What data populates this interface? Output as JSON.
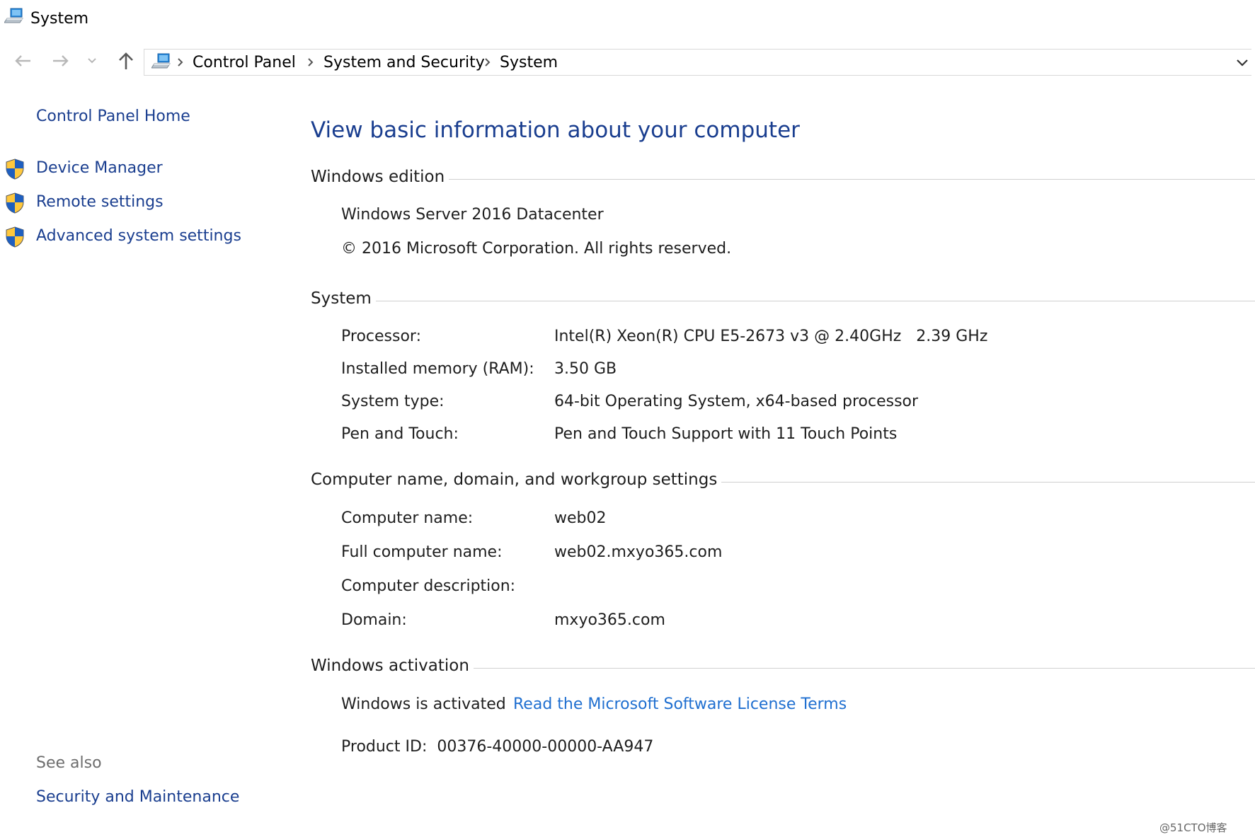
{
  "window": {
    "title": "System",
    "icon": "computer-icon"
  },
  "nav": {
    "back_icon": "back-arrow-icon",
    "forward_icon": "forward-arrow-icon",
    "recent_icon": "chevron-down-icon",
    "up_icon": "up-arrow-icon",
    "breadcrumb": [
      "Control Panel",
      "System and Security",
      "System"
    ]
  },
  "sidebar": {
    "home": "Control Panel Home",
    "items": [
      {
        "label": "Device Manager",
        "icon": "uac-shield-icon"
      },
      {
        "label": "Remote settings",
        "icon": "uac-shield-icon"
      },
      {
        "label": "Advanced system settings",
        "icon": "uac-shield-icon"
      }
    ],
    "see_also_label": "See also",
    "see_also_links": [
      "Security and Maintenance"
    ]
  },
  "main": {
    "heading": "View basic information about your computer",
    "edition": {
      "title": "Windows edition",
      "name": "Windows Server 2016 Datacenter",
      "copyright": "© 2016 Microsoft Corporation. All rights reserved."
    },
    "system": {
      "title": "System",
      "rows": [
        {
          "label": "Processor:",
          "value": "Intel(R) Xeon(R) CPU E5-2673 v3 @ 2.40GHz   2.39 GHz"
        },
        {
          "label": "Installed memory (RAM):",
          "value": "3.50 GB"
        },
        {
          "label": "System type:",
          "value": "64-bit Operating System, x64-based processor"
        },
        {
          "label": "Pen and Touch:",
          "value": "Pen and Touch Support with 11 Touch Points"
        }
      ]
    },
    "computer_name": {
      "title": "Computer name, domain, and workgroup settings",
      "rows": [
        {
          "label": "Computer name:",
          "value": "web02"
        },
        {
          "label": "Full computer name:",
          "value": "web02.mxyo365.com"
        },
        {
          "label": "Computer description:",
          "value": ""
        },
        {
          "label": "Domain:",
          "value": "mxyo365.com"
        }
      ]
    },
    "activation": {
      "title": "Windows activation",
      "status": "Windows is activated",
      "license_link": "Read the Microsoft Software License Terms",
      "product_id": "Product ID:  00376-40000-00000-AA947"
    }
  },
  "watermark": "@51CTO博客",
  "colors": {
    "link_dark": "#1a3e8f",
    "link": "#1f6fd0",
    "rule": "#d0d0d0"
  }
}
